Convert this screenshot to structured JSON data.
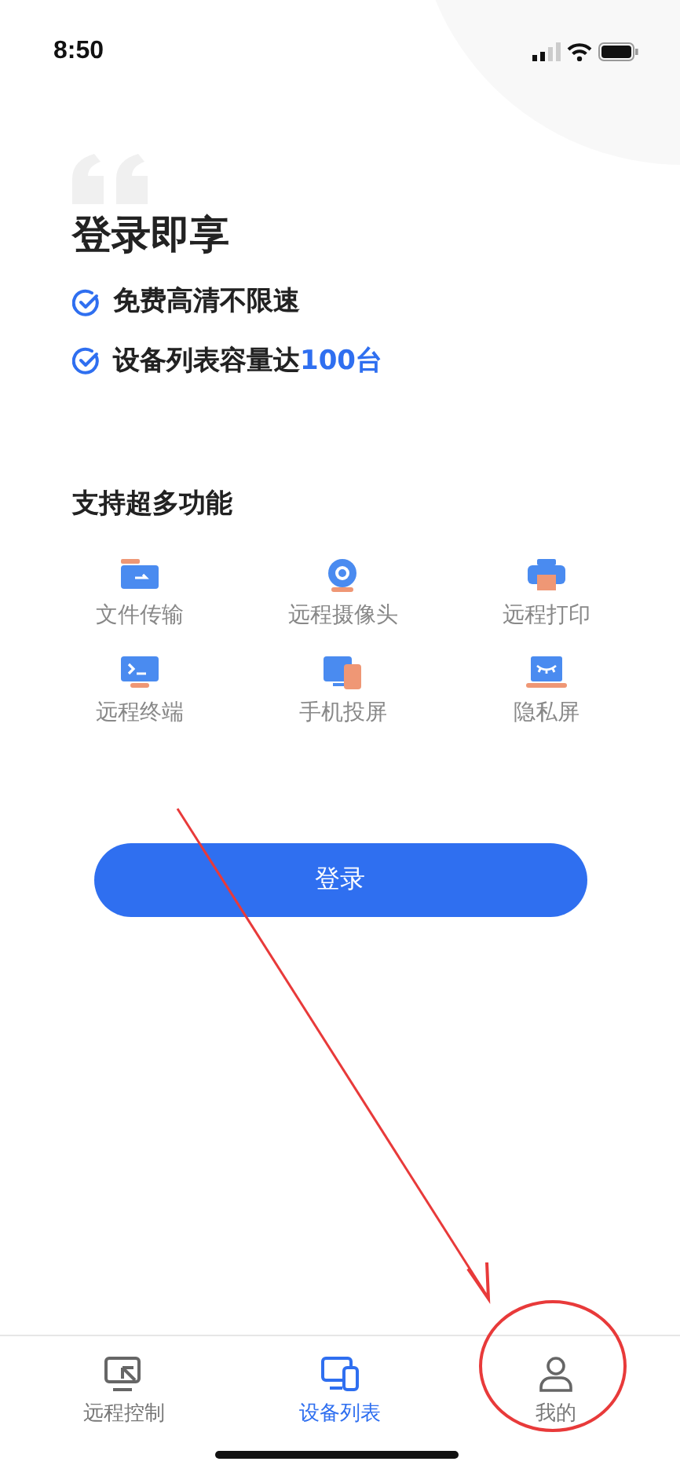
{
  "status_bar": {
    "time": "8:50"
  },
  "title": "登录即享",
  "benefits": [
    {
      "text": "免费高清不限速"
    },
    {
      "text": "设备列表容量达",
      "highlight": "100台"
    }
  ],
  "features_heading": "支持超多功能",
  "features": [
    {
      "kind": "folder",
      "label": "文件传输"
    },
    {
      "kind": "camera",
      "label": "远程摄像头"
    },
    {
      "kind": "printer",
      "label": "远程打印"
    },
    {
      "kind": "terminal",
      "label": "远程终端"
    },
    {
      "kind": "mirror",
      "label": "手机投屏"
    },
    {
      "kind": "privacy",
      "label": "隐私屏"
    }
  ],
  "login_button": "登录",
  "tabs": [
    {
      "kind": "remote",
      "label": "远程控制",
      "selected": false
    },
    {
      "kind": "devices",
      "label": "设备列表",
      "selected": true
    },
    {
      "kind": "profile",
      "label": "我的",
      "selected": false
    }
  ]
}
